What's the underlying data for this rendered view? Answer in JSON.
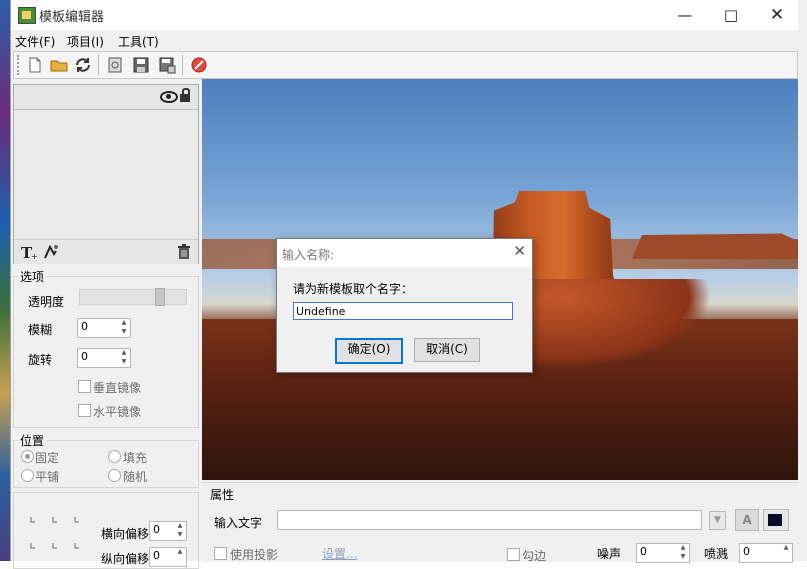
{
  "window": {
    "title": "模板编辑器",
    "minimize_icon": "minimize-icon",
    "maximize_icon": "maximize-icon",
    "close_icon": "close-icon"
  },
  "menu": [
    "文件(F)",
    "项目(I)",
    "工具(T)"
  ],
  "toolbar": {
    "icons": [
      "new-file-icon",
      "open-folder-icon",
      "refresh-icon",
      "preview-icon",
      "save-icon",
      "save-as-icon",
      "stop-icon"
    ]
  },
  "layers": {
    "eye_icon": "eye-icon",
    "lock_icon": "lock-icon",
    "add_text_icon": "add-text-icon",
    "add_image_icon": "add-image-icon",
    "delete_icon": "trash-icon"
  },
  "options": {
    "title": "选项",
    "opacity_label": "透明度",
    "opacity_value": 0.78,
    "blur_label": "模糊",
    "blur_value": "0",
    "rotate_label": "旋转",
    "rotate_value": "0",
    "vflip_label": "垂直镜像",
    "hflip_label": "水平镜像"
  },
  "position": {
    "title": "位置",
    "fixed": "固定",
    "fill": "填充",
    "tile": "平铺",
    "random": "随机",
    "h_offset_label": "横向偏移",
    "h_offset_value": "0",
    "v_offset_label": "纵向偏移",
    "v_offset_value": "0"
  },
  "dialog": {
    "title": "输入名称:",
    "prompt": "请为新模板取个名字：",
    "input_value": "Undefine",
    "ok": "确定(O)",
    "cancel": "取消(C)"
  },
  "properties": {
    "title": "属性",
    "input_text_label": "输入文字",
    "input_text_value": "",
    "shadow_label": "使用投影",
    "settings_link": "设置...",
    "outline_label": "勾边",
    "noise_label": "噪声",
    "noise_value": "0",
    "spray_label": "喷溅",
    "spray_value": "0",
    "color": "#0a0a2a"
  }
}
